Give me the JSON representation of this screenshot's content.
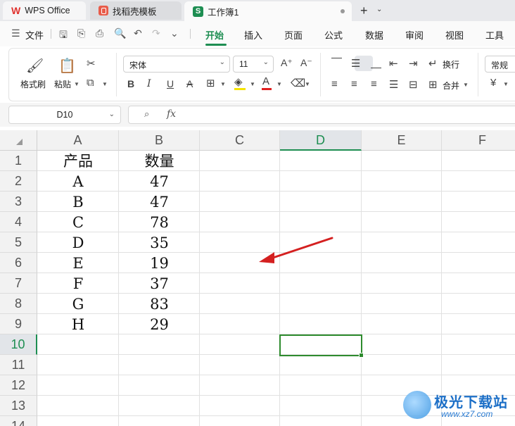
{
  "tabs": [
    {
      "label": "WPS Office"
    },
    {
      "label": "找稻壳模板"
    },
    {
      "label": "工作簿1"
    }
  ],
  "menu": {
    "file_label": "文件",
    "tabs": [
      "开始",
      "插入",
      "页面",
      "公式",
      "数据",
      "审阅",
      "视图",
      "工具"
    ],
    "active_tab": "开始"
  },
  "ribbon": {
    "format_painter": "格式刷",
    "paste": "粘贴",
    "font_name": "宋体",
    "font_size": "11",
    "wrap_text": "换行",
    "merge": "合并",
    "number_format": "常规",
    "font_color": "#e02020",
    "highlight_color": "#f5e400"
  },
  "formula_bar": {
    "name_box": "D10",
    "formula": ""
  },
  "sheet": {
    "columns": [
      "A",
      "B",
      "C",
      "D",
      "E",
      "F"
    ],
    "active_column": "D",
    "rows": [
      "1",
      "2",
      "3",
      "4",
      "5",
      "6",
      "7",
      "8",
      "9",
      "10",
      "11",
      "12",
      "13",
      "14"
    ],
    "active_row": "10",
    "cells": [
      [
        "产品",
        "数量"
      ],
      [
        "A",
        "47"
      ],
      [
        "B",
        "47"
      ],
      [
        "C",
        "78"
      ],
      [
        "D",
        "35"
      ],
      [
        "E",
        "19"
      ],
      [
        "F",
        "37"
      ],
      [
        "G",
        "83"
      ],
      [
        "H",
        "29"
      ]
    ],
    "accent_color": "#1e8e52"
  },
  "watermark": {
    "title": "极光下载站",
    "url": "www.xz7.com"
  }
}
